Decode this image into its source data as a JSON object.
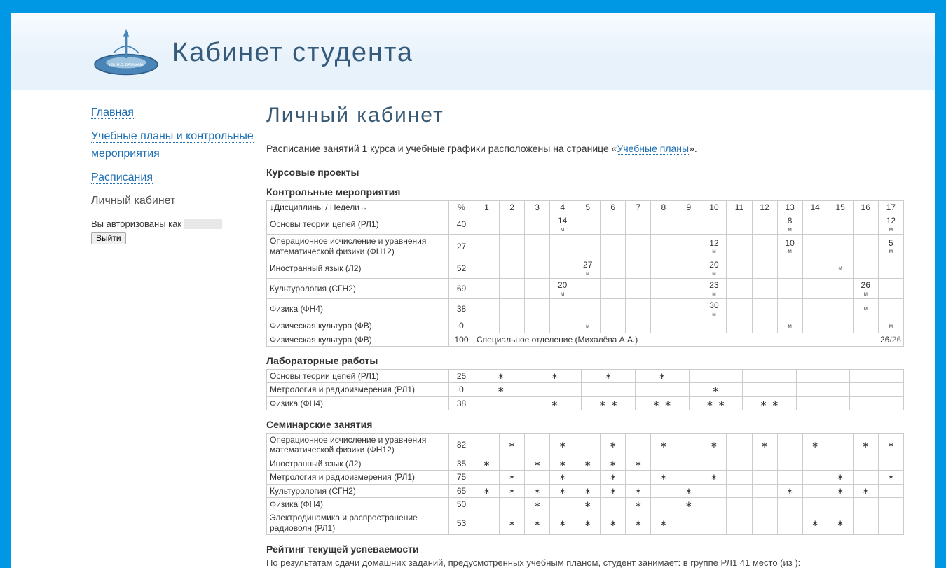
{
  "header": {
    "site_title": "Кабинет студента"
  },
  "sidebar": {
    "items": [
      {
        "label": "Главная"
      },
      {
        "label": "Учебные планы и контрольные мероприятия"
      },
      {
        "label": "Расписания"
      },
      {
        "label": "Личный кабинет"
      }
    ],
    "auth_prefix": "Вы авторизованы как ",
    "auth_user": "(скрыто)",
    "logout": "Выйти"
  },
  "page": {
    "title": "Личный кабинет",
    "intro_before": "Расписание занятий 1 курса и учебные графики расположены на странице «",
    "intro_link": "Учебные планы",
    "intro_after": "».",
    "section_coursework": "Курсовые проекты",
    "section_control": "Контрольные мероприятия",
    "section_lab": "Лабораторные работы",
    "section_seminar": "Семинарские занятия",
    "section_rating": "Рейтинг текущей успеваемости",
    "weeks_header": "↓Дисциплины / Недели→",
    "percent": "%",
    "weeks": [
      "1",
      "2",
      "3",
      "4",
      "5",
      "6",
      "7",
      "8",
      "9",
      "10",
      "11",
      "12",
      "13",
      "14",
      "15",
      "16",
      "17"
    ],
    "rating_text": "По результатам сдачи домашних заданий, предусмотренных учебным планом, студент занимает: в группе РЛ1 41 место (из ):"
  },
  "control": [
    {
      "name": "Основы теории цепей (РЛ1)",
      "pct": "40",
      "cells": [
        "",
        "",
        "",
        "14|м",
        "",
        "",
        "",
        "",
        "",
        "",
        "",
        "",
        "8|м",
        "",
        "",
        "",
        "12|м"
      ]
    },
    {
      "name": "Операционное исчисление и уравнения математической физики (ФН12)",
      "pct": "27",
      "cells": [
        "",
        "",
        "",
        "",
        "",
        "",
        "",
        "",
        "",
        "12|м",
        "",
        "",
        "10|м",
        "",
        "",
        "",
        "5|м"
      ]
    },
    {
      "name": "Иностранный язык (Л2)",
      "pct": "52",
      "cells": [
        "",
        "",
        "",
        "",
        "27|м",
        "",
        "",
        "",
        "",
        "20|м",
        "",
        "",
        "",
        "",
        "м",
        "",
        ""
      ]
    },
    {
      "name": "Культурология (СГН2)",
      "pct": "69",
      "cells": [
        "",
        "",
        "",
        "20|м",
        "",
        "",
        "",
        "",
        "",
        "23|м",
        "",
        "",
        "",
        "",
        "",
        "26|м",
        ""
      ]
    },
    {
      "name": "Физика (ФН4)",
      "pct": "38",
      "cells": [
        "",
        "",
        "",
        "",
        "",
        "",
        "",
        "",
        "",
        "30|м",
        "",
        "",
        "",
        "",
        "",
        "м",
        ""
      ]
    },
    {
      "name": "Физическая культура (ФВ)",
      "pct": "0",
      "cells": [
        "",
        "",
        "",
        "",
        "м",
        "",
        "",
        "",
        "",
        "",
        "",
        "",
        "м",
        "",
        "",
        "",
        "м"
      ]
    }
  ],
  "control_special": {
    "name": "Физическая культура (ФВ)",
    "pct": "100",
    "note": "Специальное отделение (Михалёва А.А.)",
    "ratio_num": "26",
    "ratio_den": "/26"
  },
  "lab": [
    {
      "name": "Основы теории цепей (РЛ1)",
      "pct": "25",
      "cells": [
        "",
        "∗",
        "∗",
        "",
        "",
        "∗",
        "∗",
        "",
        "",
        "",
        "",
        "",
        "",
        "",
        "",
        "",
        ""
      ]
    },
    {
      "name": "Метрология и радиоизмерения (РЛ1)",
      "pct": "0",
      "cells": [
        "",
        "∗",
        "",
        "",
        "",
        "",
        "",
        "",
        "",
        "∗",
        "",
        "",
        "",
        "",
        "",
        "",
        ""
      ]
    },
    {
      "name": "Физика (ФН4)",
      "pct": "38",
      "cells": [
        "",
        "",
        "",
        "∗",
        "∗",
        "∗",
        "∗",
        "∗",
        "∗",
        "∗",
        "∗",
        "∗",
        "",
        "",
        "",
        "",
        ""
      ]
    }
  ],
  "seminar": [
    {
      "name": "Операционное исчисление и уравнения математической физики (ФН12)",
      "pct": "82",
      "cells": [
        "",
        "∗",
        "",
        "∗",
        "",
        "∗",
        "",
        "∗",
        "",
        "∗",
        "",
        "∗",
        "",
        "∗",
        "",
        "∗",
        "∗"
      ]
    },
    {
      "name": "Иностранный язык (Л2)",
      "pct": "35",
      "cells": [
        "∗",
        "",
        "∗",
        "∗",
        "∗",
        "∗",
        "∗",
        "",
        "",
        "",
        "",
        "",
        "",
        "",
        "",
        "",
        ""
      ]
    },
    {
      "name": "Метрология и радиоизмерения (РЛ1)",
      "pct": "75",
      "cells": [
        "",
        "∗",
        "",
        "∗",
        "",
        "∗",
        "",
        "∗",
        "",
        "∗",
        "",
        "",
        "",
        "",
        "∗",
        "",
        "∗"
      ]
    },
    {
      "name": "Культурология (СГН2)",
      "pct": "65",
      "cells": [
        "∗",
        "∗",
        "∗",
        "∗",
        "∗",
        "∗",
        "∗",
        "",
        "∗",
        "",
        "",
        "",
        "∗",
        "",
        "∗",
        "∗",
        ""
      ]
    },
    {
      "name": "Физика (ФН4)",
      "pct": "50",
      "cells": [
        "",
        "",
        "∗",
        "",
        "∗",
        "",
        "∗",
        "",
        "∗",
        "",
        "",
        "",
        "",
        "",
        "",
        "",
        ""
      ]
    },
    {
      "name": "Электродинамика и распространение радиоволн (РЛ1)",
      "pct": "53",
      "cells": [
        "",
        "∗",
        "∗",
        "∗",
        "∗",
        "∗",
        "∗",
        "∗",
        "",
        "",
        "",
        "",
        "",
        "∗",
        "∗",
        "",
        ""
      ]
    }
  ]
}
